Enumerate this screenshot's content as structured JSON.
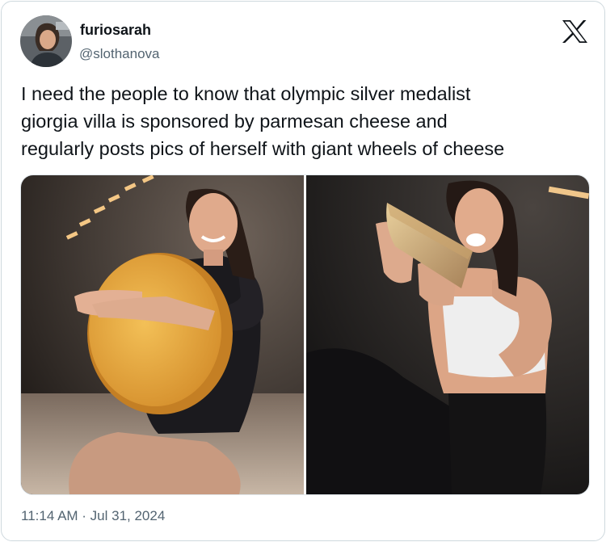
{
  "author": {
    "display_name": "furiosarah",
    "handle": "@slothanova"
  },
  "tweet": {
    "text": "I need the people to know that olympic silver medalist\ngiorgia villa is sponsored by parmesan cheese and\nregularly posts pics of herself with giant wheels of cheese",
    "timestamp": "11:14 AM · Jul 31, 2024"
  },
  "icons": {
    "platform": "x-logo-icon"
  },
  "colors": {
    "text_primary": "#0f1419",
    "text_secondary": "#536471",
    "border": "#cfd9de"
  }
}
